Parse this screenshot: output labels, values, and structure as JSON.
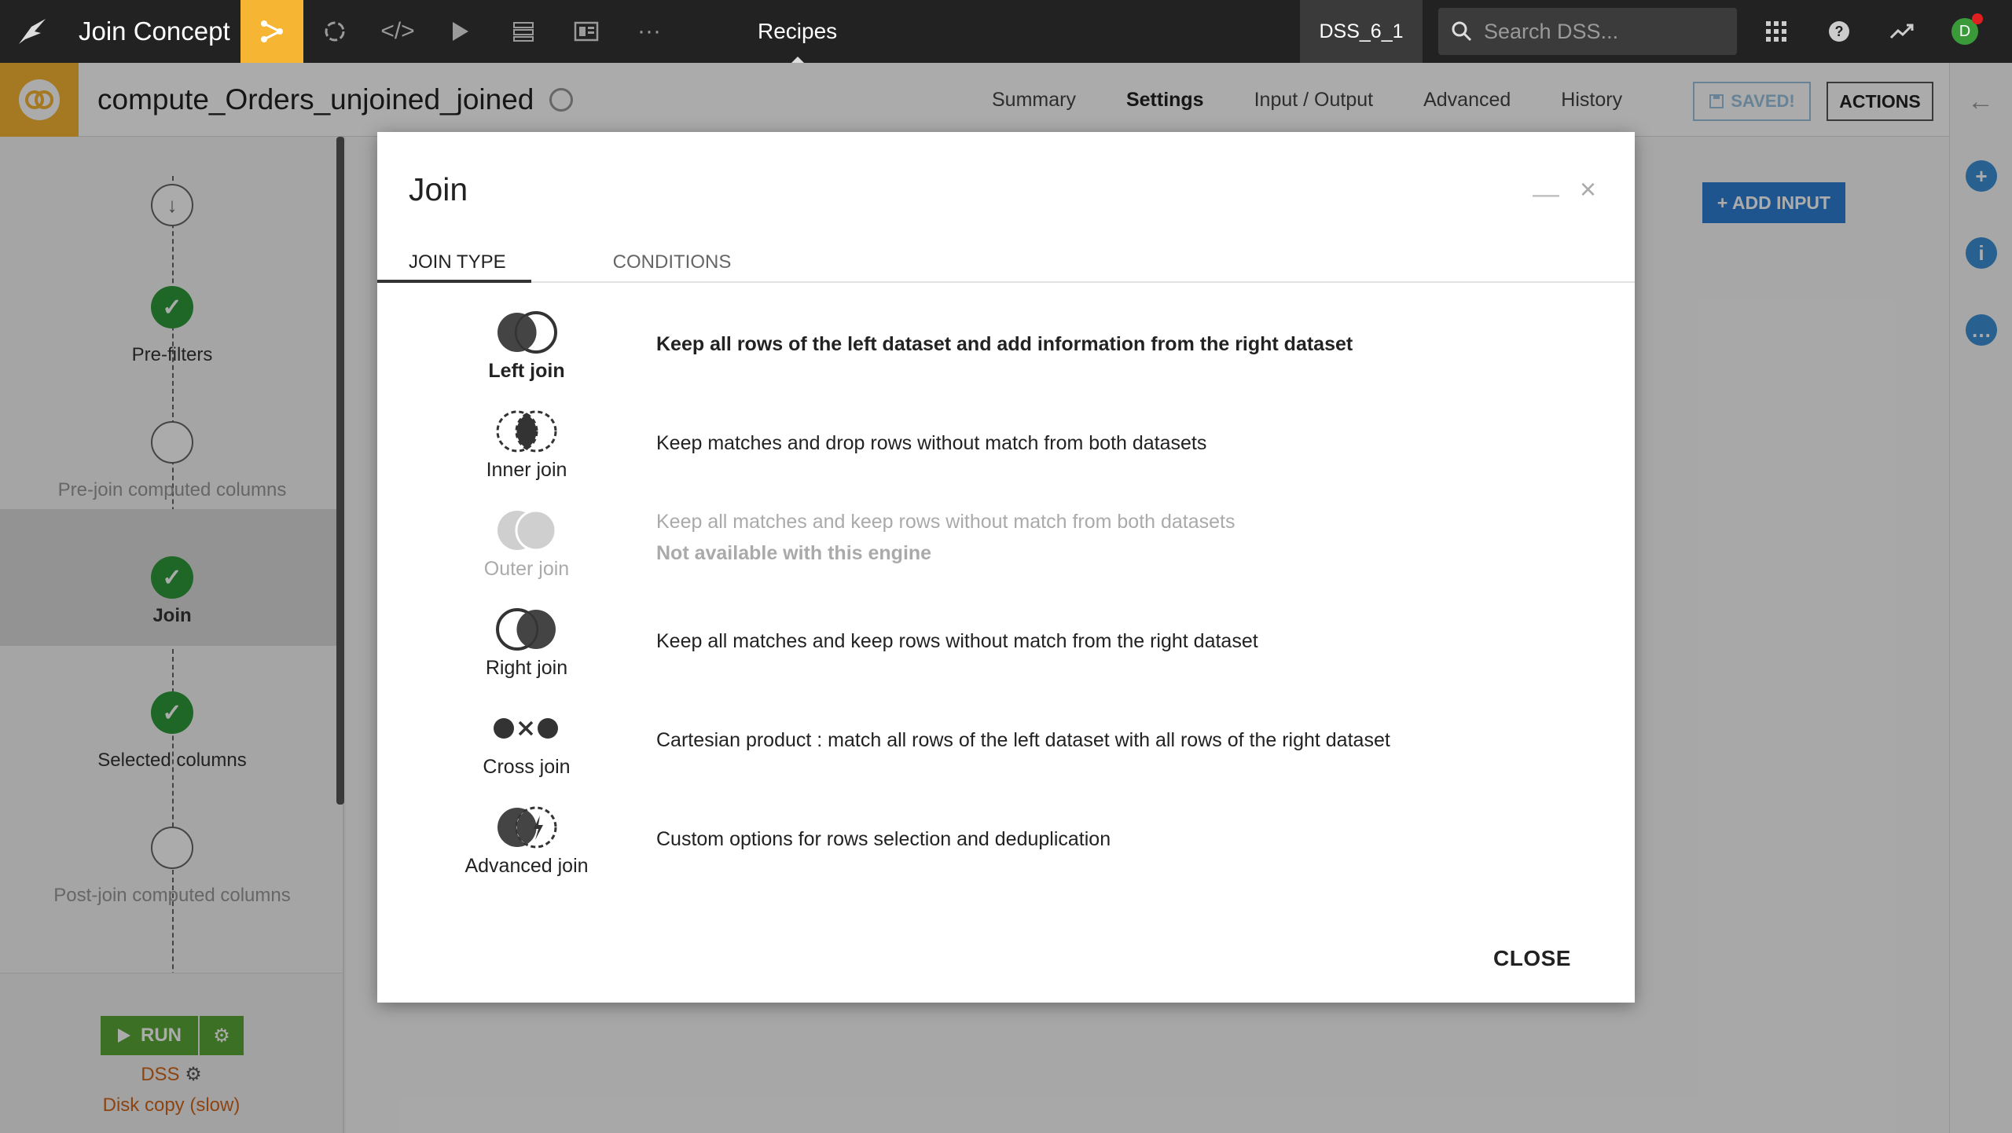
{
  "topnav": {
    "project_name": "Join Concept",
    "section": "Recipes",
    "instance": "DSS_6_1",
    "search_placeholder": "Search DSS...",
    "avatar_letter": "D"
  },
  "header": {
    "recipe_name": "compute_Orders_unjoined_joined",
    "tabs": [
      "Summary",
      "Settings",
      "Input / Output",
      "Advanced",
      "History"
    ],
    "active_tab": "Settings",
    "saved_label": "SAVED!",
    "actions_label": "ACTIONS"
  },
  "steps": {
    "items": [
      {
        "label": "Pre-filters",
        "status": "done"
      },
      {
        "label": "Pre-join computed columns",
        "status": "empty"
      },
      {
        "label": "Join",
        "status": "done"
      },
      {
        "label": "Selected columns",
        "status": "done"
      },
      {
        "label": "Post-join computed columns",
        "status": "empty"
      }
    ],
    "run_label": "RUN",
    "engine_label": "DSS",
    "engine_mode": "Disk copy (slow)"
  },
  "main": {
    "add_input_label": "+ ADD INPUT"
  },
  "modal": {
    "title": "Join",
    "tabs": [
      "JOIN TYPE",
      "CONDITIONS"
    ],
    "active_tab": "JOIN TYPE",
    "join_types": [
      {
        "name": "Left join",
        "description": "Keep all rows of the left dataset and add information from the right dataset",
        "selected": true
      },
      {
        "name": "Inner join",
        "description": "Keep matches and drop rows without match from both datasets"
      },
      {
        "name": "Outer join",
        "description": "Keep all matches and keep rows without match from both datasets",
        "note": "Not available with this engine",
        "disabled": true
      },
      {
        "name": "Right join",
        "description": "Keep all matches and keep rows without match from the right dataset"
      },
      {
        "name": "Cross join",
        "description": "Cartesian product : match all rows of the left dataset with all rows of the right dataset"
      },
      {
        "name": "Advanced join",
        "description": "Custom options for rows selection and deduplication"
      }
    ],
    "close_label": "CLOSE"
  },
  "colors": {
    "accent": "#f7b534",
    "success": "#2f9a3b",
    "primary": "#2f7fd6",
    "engine": "#d2661a"
  }
}
